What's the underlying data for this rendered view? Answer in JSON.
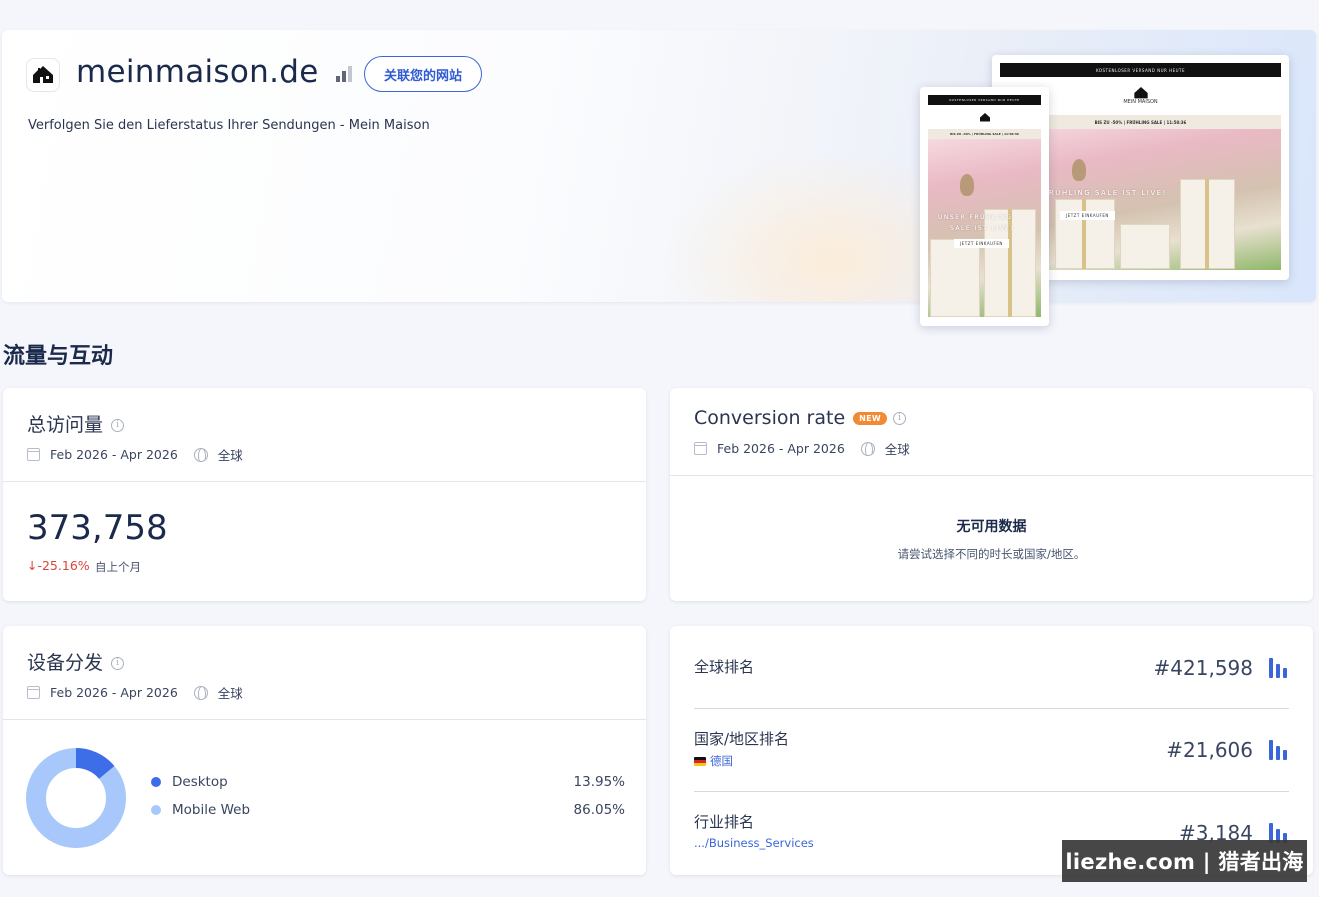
{
  "hero": {
    "site_name": "meinmaison.de",
    "connect_label": "关联您的网站",
    "description": "Verfolgen Sie den Lieferstatus Ihrer Sendungen - Mein Maison",
    "mockup": {
      "top_bar": "KOSTENLOSER VERSAND NUR HEUTE",
      "logo": "MEIN MAISON",
      "sale_banner": "BIS ZU -50% | FRÜHLING SALE | 11:58:36",
      "mobile_sale_banner": "BIS ZU -50% | FRÜHLING SALE | 11:58:36",
      "headline": "UNSER FRÜHLING SALE IST LIVE!",
      "mobile_headline_1": "UNSER FRÜHLING",
      "mobile_headline_2": "SALE IST LIVE!",
      "cta": "JETZT EINKAUFEN"
    }
  },
  "section_title": "流量与互动",
  "visits": {
    "title": "总访问量",
    "date_range": "Feb 2026 - Apr 2026",
    "region": "全球",
    "value": "373,758",
    "change": "↓-25.16%",
    "change_label": "自上个月"
  },
  "conversion": {
    "title": "Conversion rate",
    "badge": "NEW",
    "date_range": "Feb 2026 - Apr 2026",
    "region": "全球",
    "no_data_title": "无可用数据",
    "no_data_sub": "请尝试选择不同的时长或国家/地区。"
  },
  "devices": {
    "title": "设备分发",
    "date_range": "Feb 2026 - Apr 2026",
    "region": "全球",
    "items": [
      {
        "label": "Desktop",
        "pct": "13.95%",
        "value": 13.95,
        "color": "#3d6ee8"
      },
      {
        "label": "Mobile Web",
        "pct": "86.05%",
        "value": 86.05,
        "color": "#a8c7fa"
      }
    ]
  },
  "ranks": {
    "global_label": "全球排名",
    "global_value": "#421,598",
    "country_label": "国家/地区排名",
    "country_name": "德国",
    "country_value": "#21,606",
    "industry_label": "行业排名",
    "industry_name": ".../Business_Services",
    "industry_value": "#3,184"
  },
  "watermark": "liezhe.com | 猎者出海",
  "colors": {
    "accent": "#3a66d8",
    "negative": "#d8453a",
    "badge": "#f18a35"
  }
}
